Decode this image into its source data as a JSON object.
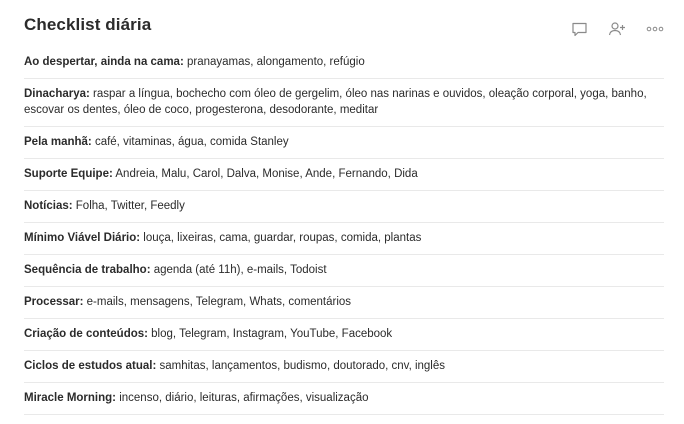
{
  "page": {
    "title": "Checklist diária"
  },
  "toolbar": {
    "icons": [
      "comment-icon",
      "add-person-icon",
      "more-icon"
    ]
  },
  "items": [
    {
      "label": "Ao despertar, ainda na cama:",
      "text": " pranayamas, alongamento, refúgio"
    },
    {
      "label": "Dinacharya:",
      "text": " raspar a língua, bochecho com óleo de gergelim, óleo nas narinas e ouvidos, oleação corporal, yoga, banho, escovar os dentes, óleo de coco, progesterona, desodorante, meditar"
    },
    {
      "label": "Pela manhã:",
      "text": " café, vitaminas, água, comida Stanley"
    },
    {
      "label": "Suporte Equipe:",
      "text": " Andreia, Malu, Carol, Dalva, Monise, Ande, Fernando, Dida"
    },
    {
      "label": "Notícias:",
      "text": " Folha, Twitter, Feedly"
    },
    {
      "label": "Mínimo Viável Diário:",
      "text": " louça, lixeiras, cama, guardar, roupas, comida, plantas"
    },
    {
      "label": "Sequência de trabalho:",
      "text": " agenda (até 11h), e-mails, Todoist"
    },
    {
      "label": "Processar:",
      "text": " e-mails, mensagens, Telegram, Whats, comentários"
    },
    {
      "label": "Criação de conteúdos:",
      "text": " blog, Telegram, Instagram, YouTube, Facebook"
    },
    {
      "label": "Ciclos de estudos atual:",
      "text": " samhitas, lançamentos, budismo, doutorado, cnv, inglês"
    },
    {
      "label": "Miracle Morning:",
      "text": " incenso, diário, leituras, afirmações, visualização"
    }
  ]
}
